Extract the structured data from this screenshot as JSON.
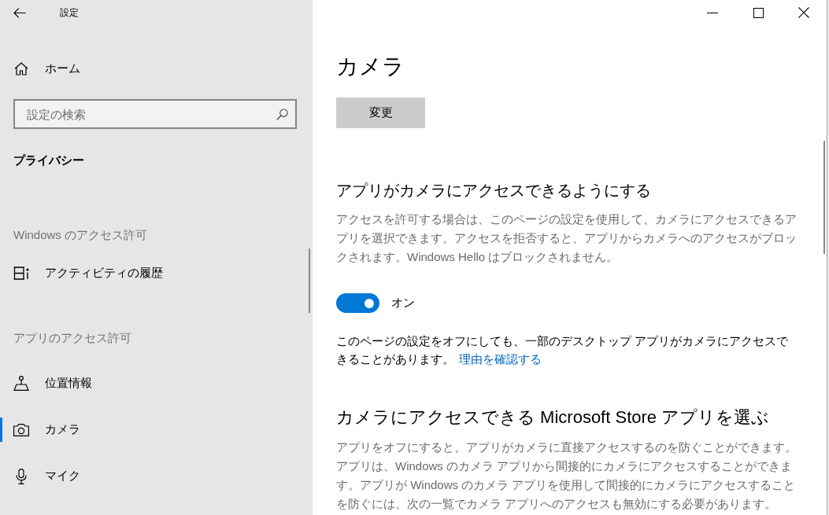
{
  "window": {
    "title": "設定"
  },
  "sidebar": {
    "home": {
      "label": "ホーム"
    },
    "search": {
      "placeholder": "設定の検索"
    },
    "section_title": "プライバシー",
    "groups": [
      {
        "heading": "Windows のアクセス許可",
        "items": [
          {
            "label": "アクティビティの履歴",
            "kind": "activity",
            "selected": false
          }
        ]
      },
      {
        "heading": "アプリのアクセス許可",
        "items": [
          {
            "label": "位置情報",
            "kind": "location",
            "selected": false
          },
          {
            "label": "カメラ",
            "kind": "camera",
            "selected": true
          },
          {
            "label": "マイク",
            "kind": "microphone",
            "selected": false
          }
        ]
      }
    ]
  },
  "page": {
    "title": "カメラ",
    "change_button": {
      "label": "変更"
    },
    "access_section": {
      "heading": "アプリがカメラにアクセスできるようにする",
      "description": "アクセスを許可する場合は、このページの設定を使用して、カメラにアクセスできるアプリを選択できます。アクセスを拒否すると、アプリからカメラへのアクセスがブロックされます。Windows Hello はブロックされません。",
      "toggle": {
        "on": true,
        "label": "オン"
      },
      "note": {
        "text": "このページの設定をオフにしても、一部のデスクトップ アプリがカメラにアクセスできることがあります。",
        "link": "理由を確認する"
      }
    },
    "store_apps_section": {
      "heading": "カメラにアクセスできる Microsoft Store アプリを選ぶ",
      "description": "アプリをオフにすると、アプリがカメラに直接アクセスするのを防ぐことができます。アプリは、Windows のカメラ アプリから間接的にカメラにアクセスすることができます。アプリが Windows のカメラ アプリを使用して間接的にカメラにアクセスすることを防ぐには、次の一覧でカメラ アプリへのアクセスも無効にする必要があります。"
    }
  }
}
